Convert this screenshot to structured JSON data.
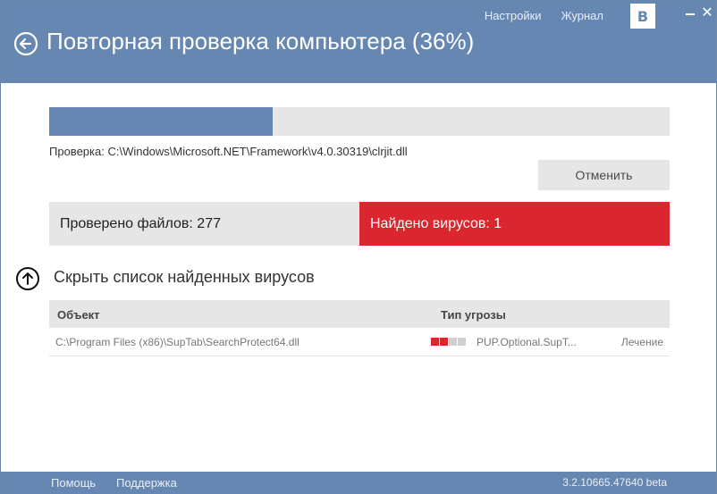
{
  "header": {
    "title": "Повторная проверка компьютера (36%)",
    "links": {
      "settings": "Настройки",
      "journal": "Журнал"
    },
    "vk_label": "B",
    "close_label": "✕",
    "color": "#6587b1"
  },
  "scan": {
    "progress_fraction": 0.36,
    "current_path": "Проверка: C:\\Windows\\Microsoft.NET\\Framework\\v4.0.30319\\clrjit.dll",
    "cancel_label": "Отменить"
  },
  "stats": {
    "checked": "Проверено файлов: 277",
    "found": "Найдено вирусов: 1",
    "found_color": "#d9262f"
  },
  "toggle": {
    "label": "Скрыть список найденных вирусов",
    "icon": "arrow-up-circle-icon"
  },
  "table": {
    "columns": {
      "object": "Объект",
      "type": "Тип угрозы"
    },
    "rows": [
      {
        "path": "C:\\Program Files (x86)\\SupTab\\SearchProtect64.dll",
        "severity_level": 2,
        "severity_max": 4,
        "threat": "PUP.Optional.SupT...",
        "action": "Лечение"
      }
    ]
  },
  "footer": {
    "help": "Помощь",
    "support": "Поддержка",
    "version": "3.2.10665.47640 beta"
  }
}
